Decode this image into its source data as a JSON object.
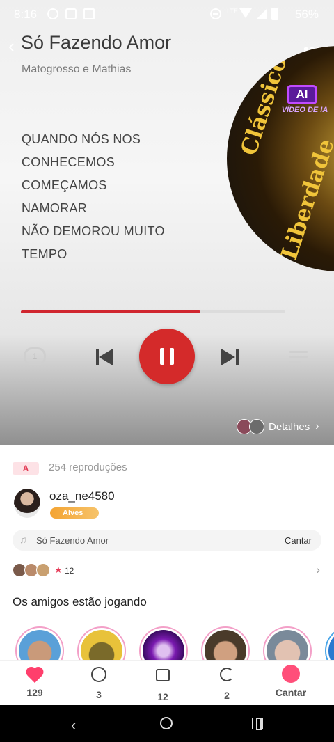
{
  "status_bar": {
    "time": "8:16",
    "network_label": "LTE",
    "battery_percent": "56%"
  },
  "player": {
    "title": "Só Fazendo Amor",
    "artist": "Matogrosso e Mathias",
    "lyrics": [
      "QUANDO NÓS NOS",
      "CONHECEMOS",
      "COMEÇAMOS",
      "NAMORAR",
      "NÃO DEMOROU MUITO",
      "TEMPO"
    ],
    "progress_fraction": 0.68,
    "album_art_text": [
      "Clássicos da",
      "Liberdade"
    ],
    "ai_badge": {
      "box": "AI",
      "label": "VÍDEO DE IA"
    },
    "details_label": "Detalhes",
    "accent_color": "#d42a2a"
  },
  "info": {
    "rank": "A",
    "plays": "254 reproduções",
    "username": "oza_ne4580",
    "level_badge": "Alves",
    "song_bar": {
      "title": "Só Fazendo Amor",
      "sing": "Cantar"
    },
    "likes_count": "12",
    "friends_title": "Os amigos estão jogando"
  },
  "bottom_bar": {
    "tabs": [
      {
        "icon": "heart-icon",
        "label": "129"
      },
      {
        "icon": "comment-icon",
        "label": "3"
      },
      {
        "icon": "gift-icon",
        "label": "12"
      },
      {
        "icon": "share-icon",
        "label": "2"
      },
      {
        "icon": "sing-icon",
        "label": "Cantar"
      }
    ]
  }
}
